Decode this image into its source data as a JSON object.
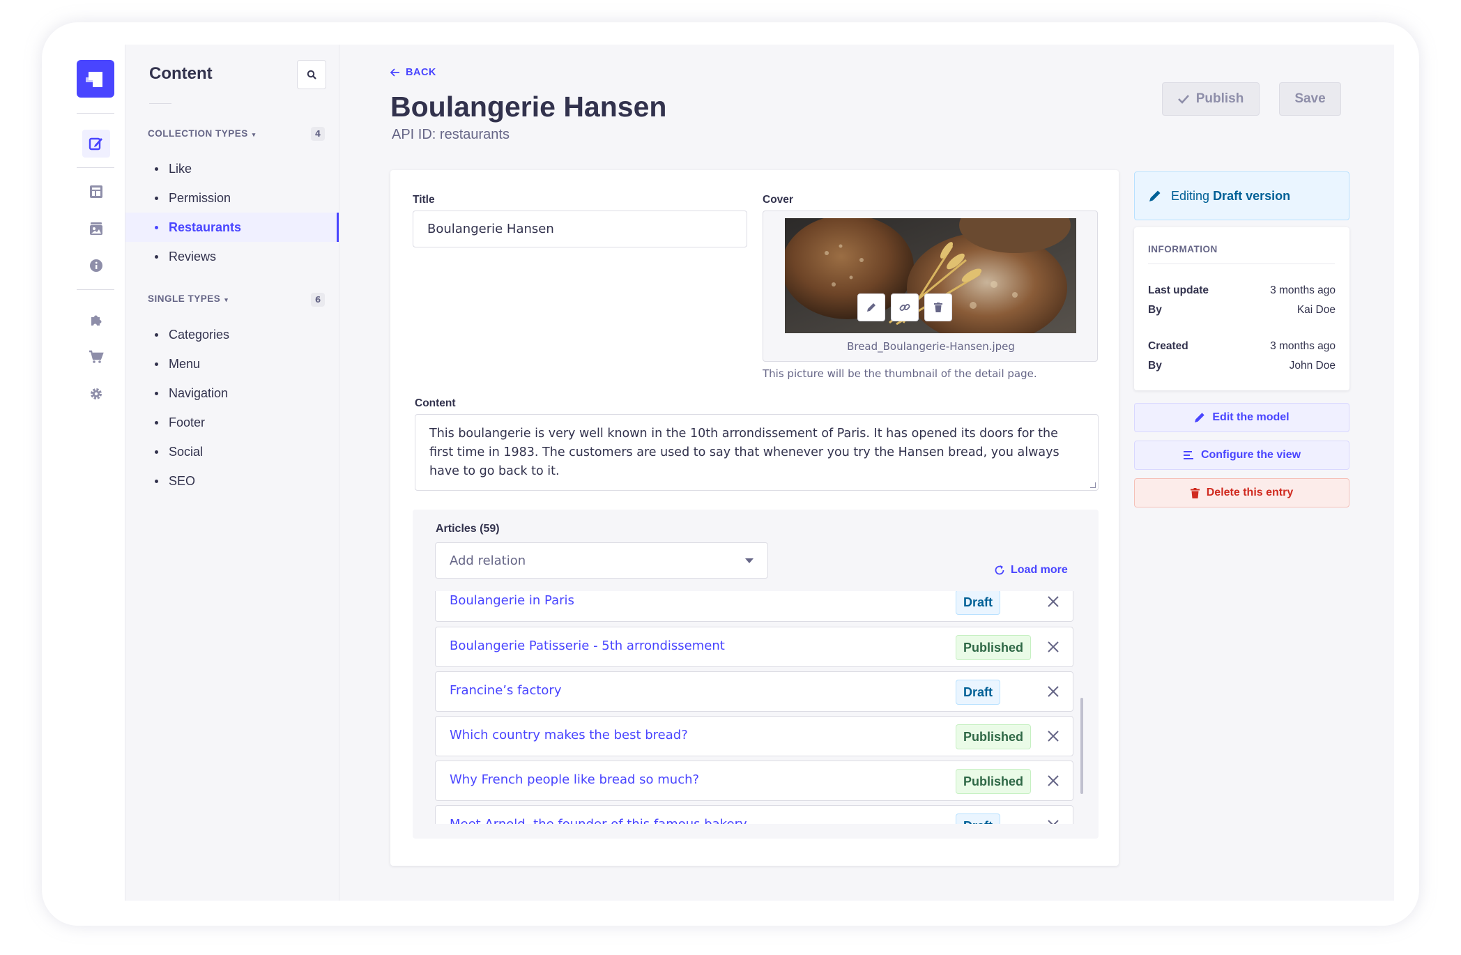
{
  "sidebar": {
    "title": "Content",
    "collection_types": {
      "label": "COLLECTION TYPES",
      "count": "4",
      "items": [
        "Like",
        "Permission",
        "Restaurants",
        "Reviews"
      ]
    },
    "single_types": {
      "label": "SINGLE TYPES",
      "count": "6",
      "items": [
        "Categories",
        "Menu",
        "Navigation",
        "Footer",
        "Social",
        "SEO"
      ]
    },
    "active_item": "Restaurants"
  },
  "rail_icons": [
    "content-manager-icon",
    "content-type-builder-icon",
    "media-library-icon",
    "info-icon",
    "plugins-icon",
    "marketplace-icon",
    "settings-icon"
  ],
  "header": {
    "back_label": "BACK",
    "title": "Boulangerie Hansen",
    "api_id": "API ID: restaurants",
    "publish_label": "Publish",
    "save_label": "Save"
  },
  "form": {
    "title_label": "Title",
    "title_value": "Boulangerie Hansen",
    "cover_label": "Cover",
    "cover_filename": "Bread_Boulangerie-Hansen.jpeg",
    "cover_hint": "This picture will be the thumbnail of the detail page.",
    "content_label": "Content",
    "content_value": "This boulangerie is very well known in the 10th arrondissement of Paris. It has opened its doors for the first time in 1983. The customers are used to say that whenever you try the Hansen bread, you always have to go back to it."
  },
  "relations": {
    "label": "Articles (59)",
    "placeholder": "Add relation",
    "load_more_label": "Load more",
    "items": [
      {
        "title": "Boulangerie in Paris",
        "status": "Draft"
      },
      {
        "title": "Boulangerie Patisserie - 5th arrondissement",
        "status": "Published"
      },
      {
        "title": "Francine’s factory",
        "status": "Draft"
      },
      {
        "title": "Which country makes the best bread?",
        "status": "Published"
      },
      {
        "title": "Why French people like bread so much?",
        "status": "Published"
      },
      {
        "title": "Meet Arnold, the founder of this famous bakery",
        "status": "Draft"
      }
    ]
  },
  "side": {
    "banner_prefix": "Editing",
    "banner_emph": "Draft version",
    "info_heading": "INFORMATION",
    "last_update_label": "Last update",
    "last_update_value": "3 months ago",
    "updated_by_label": "By",
    "updated_by_value": "Kai Doe",
    "created_label": "Created",
    "created_value": "3 months ago",
    "created_by_label": "By",
    "created_by_value": "John Doe",
    "edit_model_label": "Edit the model",
    "configure_view_label": "Configure the view",
    "delete_label": "Delete this entry"
  },
  "colors": {
    "primary": "#4945ff",
    "danger": "#d02b20",
    "draft": "#006096",
    "published": "#2f6846"
  }
}
